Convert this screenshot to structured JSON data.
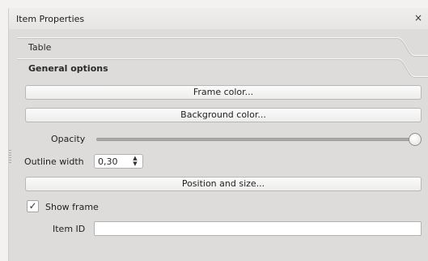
{
  "panel": {
    "title": "Item Properties",
    "close_icon": "close-icon"
  },
  "sections": {
    "table": "Table",
    "general": "General options"
  },
  "buttons": {
    "frame_color": "Frame color...",
    "background_color": "Background color...",
    "position_size": "Position and size..."
  },
  "opacity": {
    "label": "Opacity",
    "value": 1.0
  },
  "outline": {
    "label": "Outline width",
    "value": "0,30"
  },
  "show_frame": {
    "label": "Show frame",
    "checked": true
  },
  "item_id": {
    "label": "Item ID",
    "value": ""
  }
}
